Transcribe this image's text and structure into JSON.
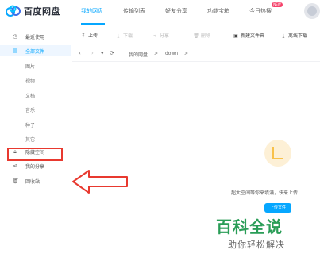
{
  "app": {
    "name": "百度网盘"
  },
  "nav": {
    "tabs": [
      "我的网盘",
      "传输列表",
      "好友分享",
      "功能宝箱",
      "今日热搜"
    ],
    "active": "我的网盘",
    "badge": "NEW"
  },
  "sidebar": {
    "recent": "最近使用",
    "all_files": "全部文件",
    "categories": [
      "图片",
      "视频",
      "文档",
      "音乐",
      "种子",
      "其它"
    ],
    "hidden_space": "隐藏空间",
    "my_share": "我的分享",
    "recycle_bin": "回收站"
  },
  "toolbar": {
    "upload": "上传",
    "download": "下载",
    "share": "分享",
    "delete": "删除",
    "new_folder": "新建文件夹",
    "offline_download": "离线下载"
  },
  "path": {
    "root": "我的网盘",
    "sep1": ">",
    "current": "down",
    "sep2": ">"
  },
  "empty_state": {
    "message": "超大空间等你来填满，快来上传",
    "upload_button": "上传文件"
  },
  "watermark": {
    "title": "百科全说",
    "subtitle": "助你轻松解决"
  },
  "colors": {
    "accent": "#06a7ff",
    "highlight": "#e8392f",
    "watermark": "#2a9d57"
  }
}
